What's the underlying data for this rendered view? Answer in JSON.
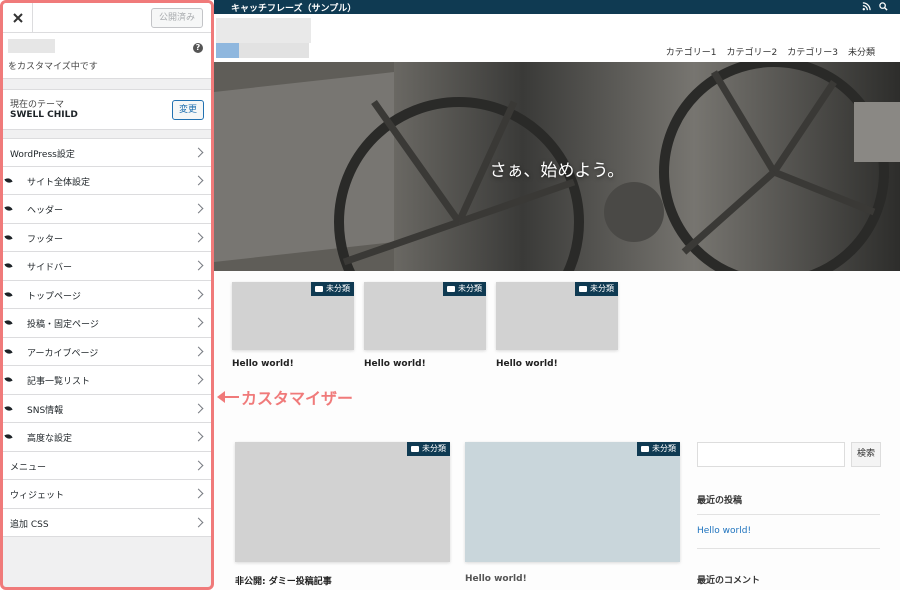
{
  "colors": {
    "accent": "#0f3a52",
    "annotation": "#f07a7a",
    "link": "#1e73be"
  },
  "customizer": {
    "close_icon": "close-icon",
    "publish_label": "公開済み",
    "customizing_text": "をカスタマイズ中です",
    "help_icon": "help-icon",
    "current_theme_label": "現在のテーマ",
    "current_theme_name": "SWELL CHILD",
    "change_button": "変更",
    "menu": [
      {
        "label": "WordPress設定",
        "child": false
      },
      {
        "label": "サイト全体設定",
        "child": true
      },
      {
        "label": "ヘッダー",
        "child": true
      },
      {
        "label": "フッター",
        "child": true
      },
      {
        "label": "サイドバー",
        "child": true
      },
      {
        "label": "トップページ",
        "child": true
      },
      {
        "label": "投稿・固定ページ",
        "child": true
      },
      {
        "label": "アーカイブページ",
        "child": true
      },
      {
        "label": "記事一覧リスト",
        "child": true
      },
      {
        "label": "SNS情報",
        "child": true
      },
      {
        "label": "高度な設定",
        "child": true
      },
      {
        "label": "メニュー",
        "child": false
      },
      {
        "label": "ウィジェット",
        "child": false
      },
      {
        "label": "追加 CSS",
        "child": false
      }
    ]
  },
  "annotation": {
    "text": "カスタマイザー"
  },
  "preview": {
    "tagline": "キャッチフレーズ（サンプル）",
    "nav": [
      "カテゴリー1",
      "カテゴリー2",
      "カテゴリー3",
      "未分類"
    ],
    "hero_title": "さぁ、始めよう。",
    "top_cards": [
      {
        "badge": "未分類",
        "title": "Hello world!"
      },
      {
        "badge": "未分類",
        "title": "Hello world!"
      },
      {
        "badge": "未分類",
        "title": "Hello world!"
      }
    ],
    "main_cards": [
      {
        "badge": "未分類",
        "title": "非公開: ダミー投稿記事"
      },
      {
        "badge": "未分類",
        "title": "Hello world!"
      }
    ],
    "sidebar": {
      "search_button": "検索",
      "recent_posts_heading": "最近の投稿",
      "recent_post_link": "Hello world!",
      "recent_comments_heading": "最近のコメント"
    }
  }
}
